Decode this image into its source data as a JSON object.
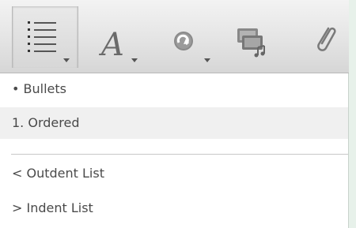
{
  "toolbar": {
    "buttons": [
      {
        "icon": "list-format-icon",
        "has_dropdown": true,
        "active": true
      },
      {
        "icon": "text-style-icon",
        "has_dropdown": true,
        "active": false
      },
      {
        "icon": "link-icon",
        "has_dropdown": true,
        "active": false
      },
      {
        "icon": "insert-media-icon",
        "has_dropdown": false,
        "active": false
      },
      {
        "icon": "paperclip-icon",
        "has_dropdown": false,
        "active": false
      }
    ],
    "text_style_glyph": "A"
  },
  "menu": {
    "items": [
      {
        "label": "• Bullets",
        "selected": false
      },
      {
        "label": "1. Ordered",
        "selected": true
      },
      {
        "label": "< Outdent List",
        "selected": false
      },
      {
        "label": "> Indent List",
        "selected": false
      }
    ]
  },
  "colors": {
    "background": "#e7f1ea",
    "toolbar": "#e4e4e4",
    "menu_text": "#4a4a4a",
    "selected_row": "#f0f0f0",
    "icon": "#666666"
  }
}
